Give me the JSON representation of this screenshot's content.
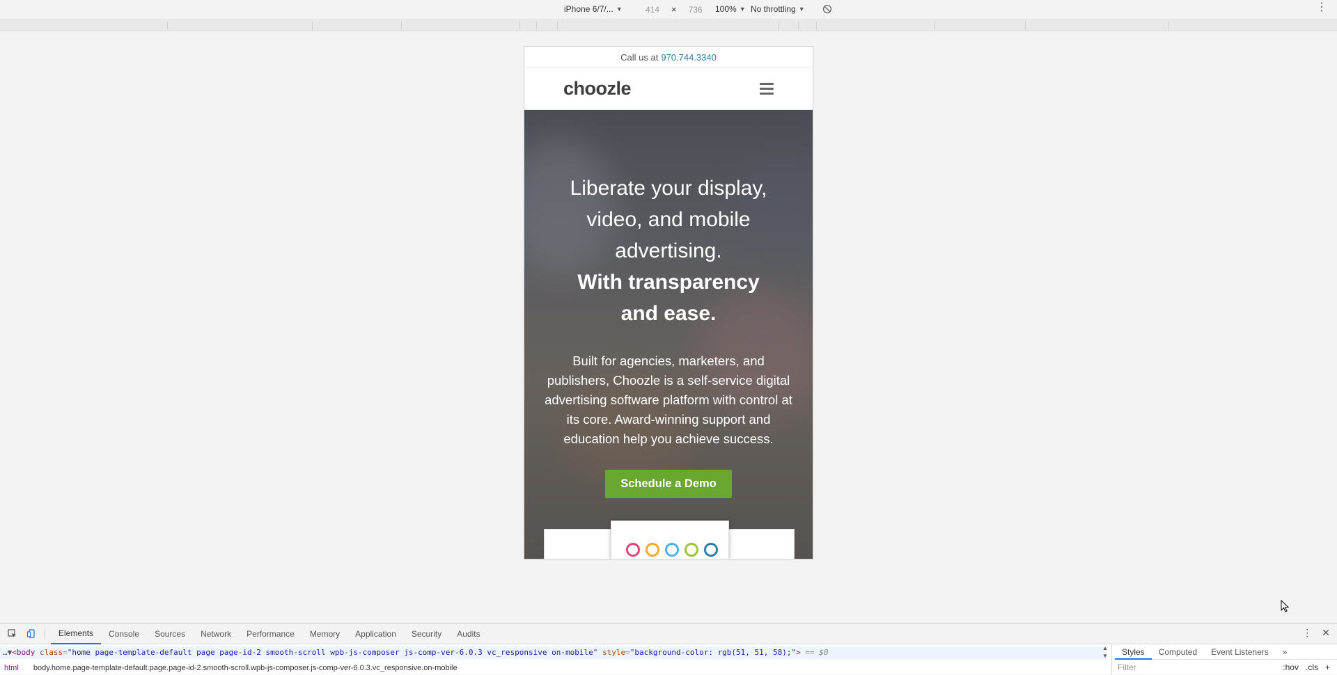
{
  "device_toolbar": {
    "device_name": "iPhone 6/7/...",
    "width": "414",
    "times": "×",
    "height": "736",
    "zoom": "100%",
    "throttling": "No throttling"
  },
  "site": {
    "call_prefix": "Call us at",
    "phone": "970.744.3340",
    "logo_text": "choozle",
    "headline_lines": [
      "Liberate your display,",
      "video, and mobile",
      "advertising."
    ],
    "headline_bold_lines": [
      "With transparency",
      "and ease."
    ],
    "subtext": "Built for agencies, marketers, and publishers, Choozle is a self-service digital advertising software platform with control at its core. Award-winning support and education help you achieve success.",
    "cta_label": "Schedule a Demo",
    "cta_color": "#6aa72e"
  },
  "devtools": {
    "tabs": [
      "Elements",
      "Console",
      "Sources",
      "Network",
      "Performance",
      "Memory",
      "Application",
      "Security",
      "Audits"
    ],
    "active_tab": "Elements",
    "code": {
      "prefix": "…▼",
      "tag_open": "<body",
      "attr_class": "class",
      "class_value": "\"home page-template-default page page-id-2 smooth-scroll wpb-js-composer js-comp-ver-6.0.3 vc_responsive on-mobile\"",
      "attr_style": "style",
      "style_value": "\"background-color: rgb(51, 51, 58);\"",
      "tag_close": ">",
      "suffix": "== $0"
    },
    "breadcrumb_root": "html",
    "breadcrumb_path": "body.home.page-template-default.page.page-id-2.smooth-scroll.wpb-js-composer.js-comp-ver-6.0.3.vc_responsive.on-mobile",
    "styles_tabs": [
      "Styles",
      "Computed",
      "Event Listeners"
    ],
    "filter_placeholder": "Filter",
    "hov_label": ":hov",
    "cls_label": ".cls",
    "add_label": "+"
  }
}
